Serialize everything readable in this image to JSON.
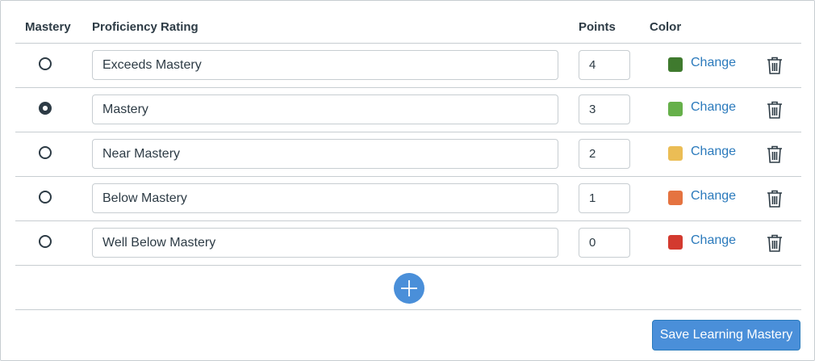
{
  "headers": {
    "mastery": "Mastery",
    "proficiency_rating": "Proficiency Rating",
    "points": "Points",
    "color": "Color"
  },
  "ratings": [
    {
      "name": "Exceeds Mastery",
      "points": "4",
      "color": "#3f7a2e",
      "change_label": "Change",
      "is_mastery": false
    },
    {
      "name": "Mastery",
      "points": "3",
      "color": "#66b04a",
      "change_label": "Change",
      "is_mastery": true
    },
    {
      "name": "Near Mastery",
      "points": "2",
      "color": "#ebbd55",
      "change_label": "Change",
      "is_mastery": false
    },
    {
      "name": "Below Mastery",
      "points": "1",
      "color": "#e57340",
      "change_label": "Change",
      "is_mastery": false
    },
    {
      "name": "Well Below Mastery",
      "points": "0",
      "color": "#d33a2f",
      "change_label": "Change",
      "is_mastery": false
    }
  ],
  "icons": {
    "add": "plus-icon",
    "delete": "trash-icon"
  },
  "accent_color": "#4a8fd9",
  "link_color": "#2b7abc",
  "save_label": "Save Learning Mastery"
}
